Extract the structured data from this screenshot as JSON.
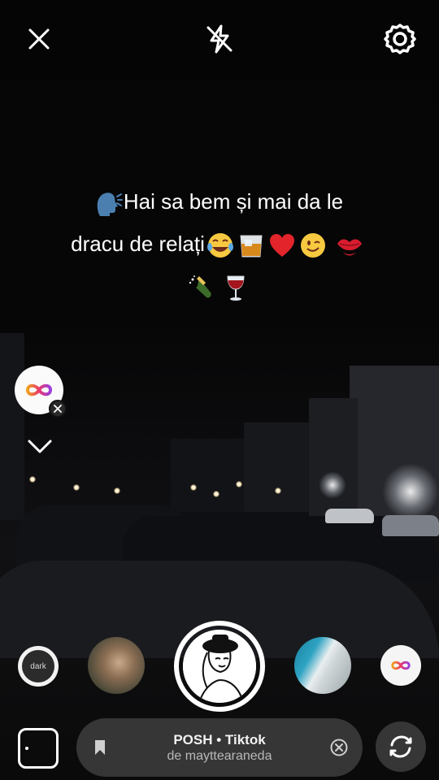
{
  "caption": {
    "line1": "Hai sa bem și mai da le",
    "line2": "dracu de relați"
  },
  "top_bar": {
    "close_icon": "close-icon",
    "flash_icon": "flash-off-icon",
    "settings_icon": "gear-icon"
  },
  "effects": {
    "dark_label": "dark"
  },
  "music": {
    "title": "POSH • Tiktok",
    "subtitle": "de mayttearaneda"
  },
  "colors": {
    "background": "#000000",
    "pill": "#464648",
    "text": "#ffffff",
    "infinity_orange": "#f0a020",
    "infinity_purple": "#9b3fe0"
  }
}
